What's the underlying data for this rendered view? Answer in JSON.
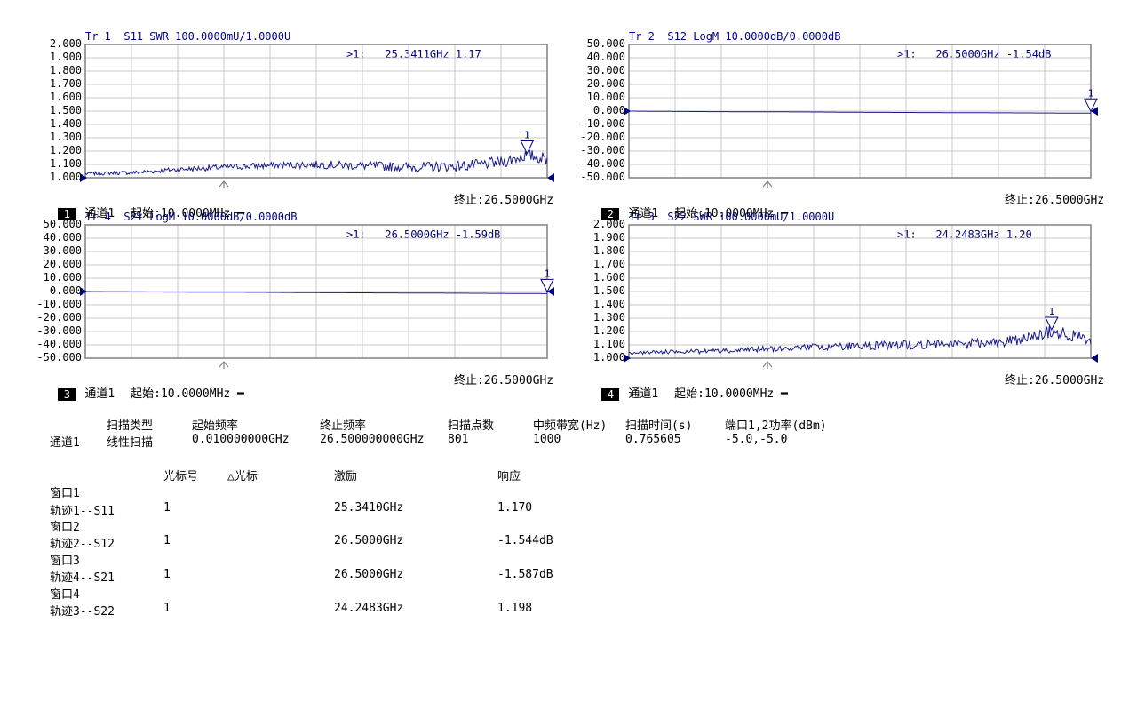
{
  "charts": [
    {
      "id": "p1",
      "hdr": "Tr 1  S11 SWR 100.0000mU/1.0000U",
      "marker_text": ">1:   25.3411GHz 1.17",
      "yticks": [
        "2.000",
        "1.900",
        "1.800",
        "1.700",
        "1.600",
        "1.500",
        "1.400",
        "1.300",
        "1.200",
        "1.100",
        "1.000"
      ],
      "foot_num": "1",
      "foot_ch": "通道1",
      "foot_start": "起始:10.0000MHz",
      "foot_stop": "终止:26.5000GHz"
    },
    {
      "id": "p2",
      "hdr": "Tr 2  S12 LogM 10.0000dB/0.0000dB",
      "marker_text": ">1:   26.5000GHz -1.54dB",
      "yticks": [
        "50.000",
        "40.000",
        "30.000",
        "20.000",
        "10.000",
        "0.000",
        "-10.000",
        "-20.000",
        "-30.000",
        "-40.000",
        "-50.000"
      ],
      "foot_num": "2",
      "foot_ch": "通道1",
      "foot_start": "起始:10.0000MHz",
      "foot_stop": "终止:26.5000GHz"
    },
    {
      "id": "p3",
      "hdr": "Tr 4  S21 LogM 10.0000dB/0.0000dB",
      "marker_text": ">1:   26.5000GHz -1.59dB",
      "yticks": [
        "50.000",
        "40.000",
        "30.000",
        "20.000",
        "10.000",
        "0.000",
        "-10.000",
        "-20.000",
        "-30.000",
        "-40.000",
        "-50.000"
      ],
      "foot_num": "3",
      "foot_ch": "通道1",
      "foot_start": "起始:10.0000MHz",
      "foot_stop": "终止:26.5000GHz"
    },
    {
      "id": "p4",
      "hdr": "Tr 3  S22 SWR 100.0000mU/1.0000U",
      "marker_text": ">1:   24.2483GHz 1.20",
      "yticks": [
        "2.000",
        "1.900",
        "1.800",
        "1.700",
        "1.600",
        "1.500",
        "1.400",
        "1.300",
        "1.200",
        "1.100",
        "1.000"
      ],
      "foot_num": "4",
      "foot_ch": "通道1",
      "foot_start": "起始:10.0000MHz",
      "foot_stop": "终止:26.5000GHz"
    }
  ],
  "chart_data": [
    {
      "type": "line",
      "title": "Tr 1  S11 SWR 100.0000mU/1.0000U",
      "x_range_ghz": [
        0.01,
        26.5
      ],
      "ylim": [
        1.0,
        2.0
      ],
      "series": [
        {
          "name": "S11",
          "x": [
            0.01,
            3,
            5,
            8,
            10,
            13,
            16,
            19,
            22,
            24,
            25.3411,
            26.5
          ],
          "y": [
            1.03,
            1.04,
            1.06,
            1.08,
            1.09,
            1.1,
            1.09,
            1.08,
            1.09,
            1.12,
            1.17,
            1.14
          ]
        }
      ],
      "markers": [
        {
          "label": "1",
          "x": 25.3411,
          "y": 1.17
        }
      ],
      "grid": true
    },
    {
      "type": "line",
      "title": "Tr 2  S12 LogM 10.0000dB/0.0000dB",
      "x_range_ghz": [
        0.01,
        26.5
      ],
      "ylim": [
        -50,
        50
      ],
      "series": [
        {
          "name": "S12",
          "x": [
            0.01,
            2,
            5,
            10,
            13.5,
            18,
            22,
            26.5
          ],
          "y": [
            0.0,
            -0.2,
            -0.4,
            -0.6,
            -0.9,
            -1.1,
            -1.3,
            -1.54
          ]
        }
      ],
      "markers": [
        {
          "label": "1",
          "x": 26.5,
          "y": -1.54
        }
      ],
      "grid": true
    },
    {
      "type": "line",
      "title": "Tr 4  S21 LogM 10.0000dB/0.0000dB",
      "x_range_ghz": [
        0.01,
        26.5
      ],
      "ylim": [
        -50,
        50
      ],
      "series": [
        {
          "name": "S21",
          "x": [
            0.01,
            2,
            5,
            10,
            13.5,
            18,
            22,
            26.5
          ],
          "y": [
            0.0,
            -0.2,
            -0.4,
            -0.6,
            -0.9,
            -1.1,
            -1.3,
            -1.59
          ]
        }
      ],
      "markers": [
        {
          "label": "1",
          "x": 26.5,
          "y": -1.59
        }
      ],
      "grid": true
    },
    {
      "type": "line",
      "title": "Tr 3  S22 SWR 100.0000mU/1.0000U",
      "x_range_ghz": [
        0.01,
        26.5
      ],
      "ylim": [
        1.0,
        2.0
      ],
      "series": [
        {
          "name": "S22",
          "x": [
            0.01,
            3,
            5,
            8,
            10,
            13,
            16,
            19,
            22,
            24.2483,
            26.5
          ],
          "y": [
            1.04,
            1.05,
            1.05,
            1.07,
            1.08,
            1.09,
            1.1,
            1.11,
            1.13,
            1.2,
            1.15
          ]
        }
      ],
      "markers": [
        {
          "label": "1",
          "x": 24.2483,
          "y": 1.2
        }
      ],
      "grid": true
    }
  ],
  "sweep": {
    "headers": [
      "扫描类型",
      "起始频率",
      "终止频率",
      "扫描点数",
      "中频带宽(Hz)",
      "扫描时间(s)",
      "端口1,2功率(dBm)"
    ],
    "row_label": "通道1",
    "values": [
      "线性扫描",
      "0.010000000GHz",
      "26.500000000GHz",
      "801",
      "1000",
      "0.765605",
      "-5.0,-5.0"
    ]
  },
  "markers_table": {
    "headers": [
      "光标号",
      "△光标",
      "激励",
      "响应"
    ],
    "groups": [
      {
        "window": "窗口1",
        "trace": "轨迹1--S11",
        "num": "1",
        "stim": "25.3410GHz",
        "resp": "1.170"
      },
      {
        "window": "窗口2",
        "trace": "轨迹2--S12",
        "num": "1",
        "stim": "26.5000GHz",
        "resp": "-1.544dB"
      },
      {
        "window": "窗口3",
        "trace": "轨迹4--S21",
        "num": "1",
        "stim": "26.5000GHz",
        "resp": "-1.587dB"
      },
      {
        "window": "窗口4",
        "trace": "轨迹3--S22",
        "num": "1",
        "stim": "24.2483GHz",
        "resp": "1.198"
      }
    ]
  },
  "colors": {
    "trace": "#1a1a8c",
    "grid": "#c8c8c8",
    "text_header": "#000080",
    "frame": "#808080"
  }
}
